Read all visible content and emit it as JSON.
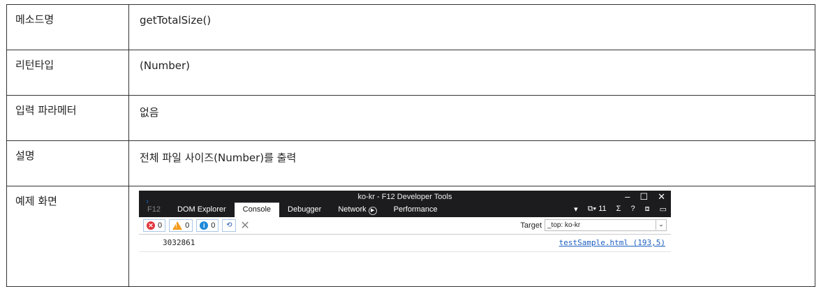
{
  "rows": [
    {
      "label": "메소드명",
      "value": "getTotalSize()"
    },
    {
      "label": "리턴타입",
      "value": "(Number)"
    },
    {
      "label": "입력 파라메터",
      "value": "없음"
    },
    {
      "label": "설명",
      "value": "전체 파일 사이즈(Number)를 출력"
    },
    {
      "label": "예제 화면"
    }
  ],
  "devtools": {
    "window_title": "ko-kr - F12 Developer Tools",
    "tabs": [
      "F12",
      "DOM Explorer",
      "Console",
      "Debugger",
      "Network",
      "Performance"
    ],
    "active_tab": "Console",
    "right_controls": {
      "emulation_count": "11"
    },
    "counters": {
      "errors": "0",
      "warnings": "0",
      "info": "0"
    },
    "target_label": "Target",
    "target_value": "_top: ko-kr",
    "log": {
      "value": "3032861",
      "source": "testSample.html (193,5)"
    },
    "prompt": "›"
  }
}
